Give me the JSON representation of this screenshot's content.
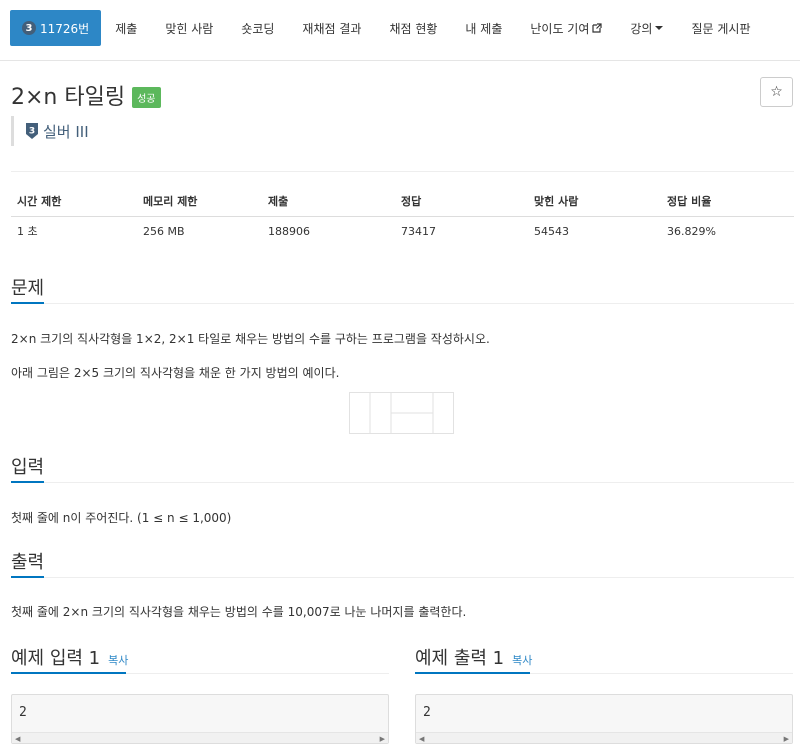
{
  "nav": {
    "problem_id": "11726번",
    "tier_num": "3",
    "items": [
      "제출",
      "맞힌 사람",
      "숏코딩",
      "재채점 결과",
      "채점 현황",
      "내 제출",
      "난이도 기여",
      "강의",
      "질문 게시판"
    ]
  },
  "problem": {
    "title": "2×n 타일링",
    "status_badge": "성공",
    "star": "☆",
    "tier_num": "3",
    "tier_label": "실버 III"
  },
  "info_table": {
    "headers": [
      "시간 제한",
      "메모리 제한",
      "제출",
      "정답",
      "맞힌 사람",
      "정답 비율"
    ],
    "row": [
      "1 초",
      "256 MB",
      "188906",
      "73417",
      "54543",
      "36.829%"
    ]
  },
  "sections": {
    "problem_title": "문제",
    "problem_p1": "2×n 크기의 직사각형을 1×2, 2×1 타일로 채우는 방법의 수를 구하는 프로그램을 작성하시오.",
    "problem_p2": "아래 그림은 2×5 크기의 직사각형을 채운 한 가지 방법의 예이다.",
    "input_title": "입력",
    "input_text": "첫째 줄에 n이 주어진다. (1 ≤ n ≤ 1,000)",
    "output_title": "출력",
    "output_text": "첫째 줄에 2×n 크기의 직사각형을 채우는 방법의 수를 10,007로 나눈 나머지를 출력한다."
  },
  "samples": {
    "input_title": "예제 입력 1",
    "output_title": "예제 출력 1",
    "copy_label": "복사",
    "input_value": "2",
    "output_value": "2"
  },
  "colors": {
    "accent": "#2d87c6",
    "success": "#5cb85c",
    "tier": "#435f7a"
  }
}
